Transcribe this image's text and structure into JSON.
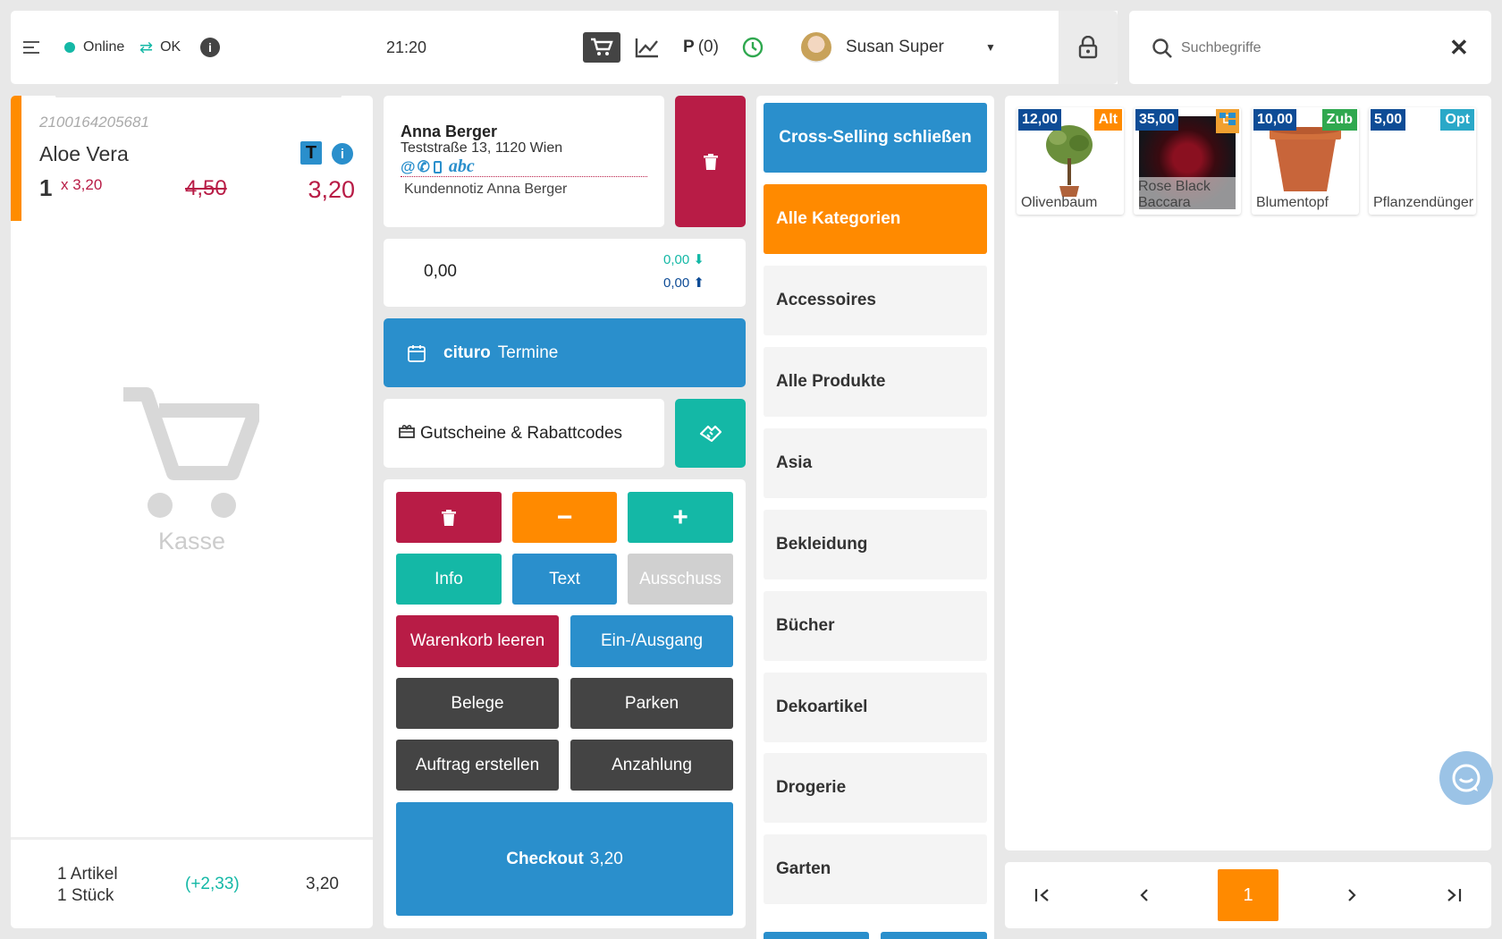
{
  "topbar": {
    "status_online": "Online",
    "status_ok": "OK",
    "time": "21:20",
    "parked_label": "P",
    "parked_count": "(0)",
    "user_name": "Susan Super"
  },
  "search": {
    "placeholder": "Suchbegriffe"
  },
  "cart": {
    "item": {
      "barcode": "2100164205681",
      "name": "Aloe Vera",
      "badge_t": "T",
      "qty": "1",
      "unit_price": "x 3,20",
      "old_price": "4,50",
      "price": "3,20"
    },
    "empty_label": "Kasse",
    "summary": {
      "articles": "1 Artikel",
      "pieces": "1 Stück",
      "margin": "(+2,33)",
      "total": "3,20"
    }
  },
  "customer": {
    "name": "Anna Berger",
    "address": "Teststraße 13, 1120 Wien",
    "contact_abc": "abc",
    "note": "Kundennotiz Anna Berger"
  },
  "balance": {
    "value": "0,00",
    "down": "0,00",
    "up": "0,00"
  },
  "appointments": {
    "brand": "cituro",
    "label": "Termine"
  },
  "vouchers": {
    "label": "Gutscheine & Rabattcodes"
  },
  "actions": {
    "info": "Info",
    "text": "Text",
    "scrap": "Ausschuss",
    "clear_cart": "Warenkorb leeren",
    "in_out": "Ein-/Ausgang",
    "receipts": "Belege",
    "park": "Parken",
    "create_order": "Auftrag erstellen",
    "deposit": "Anzahlung",
    "checkout": "Checkout",
    "checkout_amount": "3,20"
  },
  "categories": {
    "close_cross_selling": "Cross-Selling schließen",
    "all_categories": "Alle Kategorien",
    "items": [
      "Accessoires",
      "Alle Produkte",
      "Asia",
      "Bekleidung",
      "Bücher",
      "Dekoartikel",
      "Drogerie",
      "Garten"
    ]
  },
  "products": [
    {
      "price": "12,00",
      "tag": "Alt",
      "tag_color": "#ff8a00",
      "name": "Olivenbaum"
    },
    {
      "price": "35,00",
      "tag": "",
      "tag_color": "#f0a030",
      "name": "Rose Black Baccara"
    },
    {
      "price": "10,00",
      "tag": "Zub",
      "tag_color": "#2fa84f",
      "name": "Blumentopf"
    },
    {
      "price": "5,00",
      "tag": "Opt",
      "tag_color": "#2aa8c8",
      "name": "Pflanzendünger"
    }
  ],
  "pager": {
    "current": "1"
  },
  "colors": {
    "accent_blue": "#2a8fcc",
    "accent_orange": "#ff8a00",
    "accent_red": "#b81c46",
    "accent_teal": "#14b8a6",
    "dark_button": "#444444"
  }
}
